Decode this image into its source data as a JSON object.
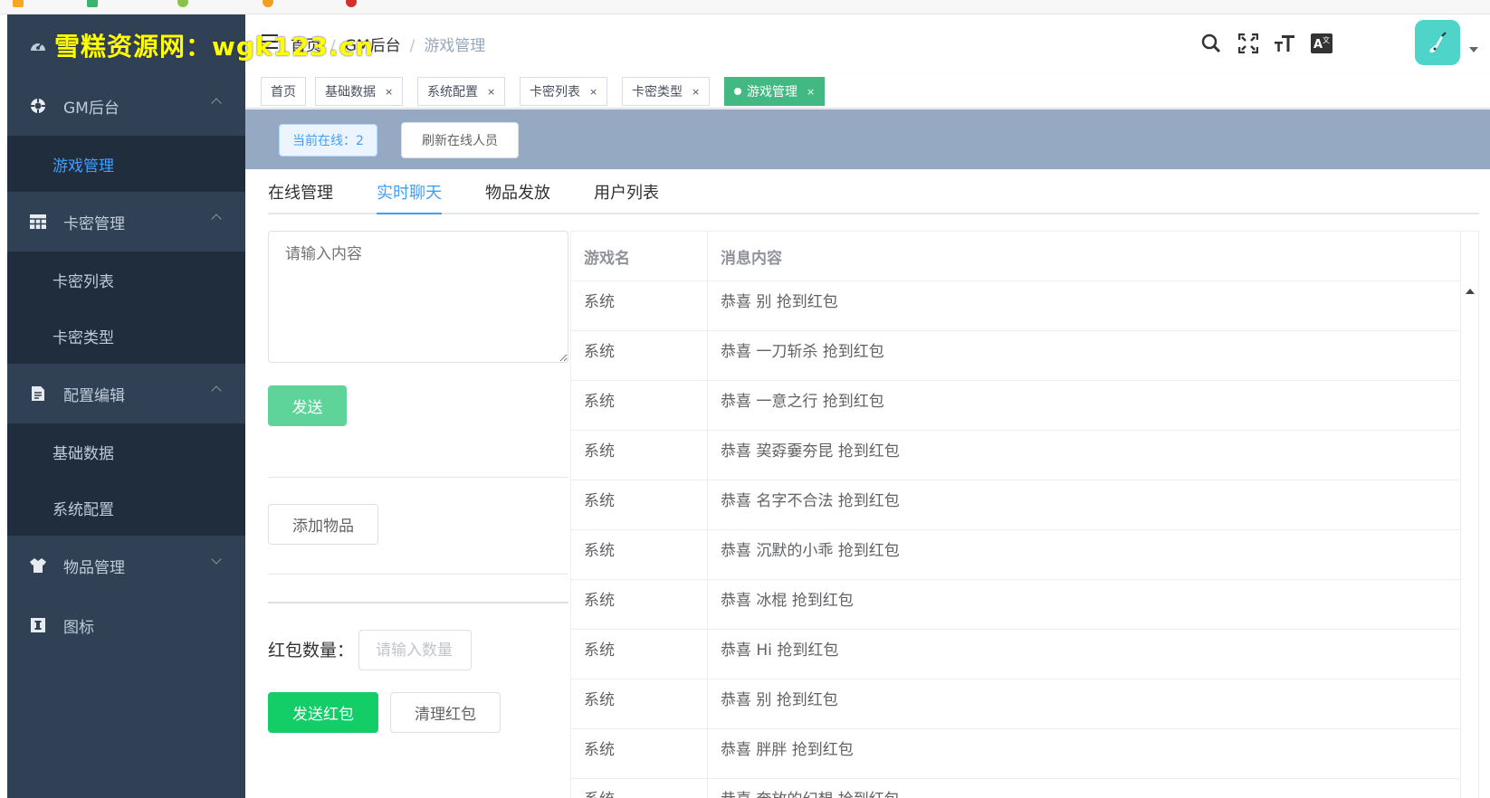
{
  "watermark": "雪糕资源网：wgk123.cn",
  "sidebar": {
    "groups": [
      {
        "label": "GM后台",
        "icon": "compass-icon",
        "expanded": true,
        "items": [
          {
            "label": "游戏管理",
            "active": true
          }
        ]
      },
      {
        "label": "卡密管理",
        "icon": "table-icon",
        "expanded": true,
        "items": [
          {
            "label": "卡密列表"
          },
          {
            "label": "卡密类型"
          }
        ]
      },
      {
        "label": "配置编辑",
        "icon": "document-icon",
        "expanded": true,
        "items": [
          {
            "label": "基础数据"
          },
          {
            "label": "系统配置"
          }
        ]
      },
      {
        "label": "物品管理",
        "icon": "shirt-icon",
        "expanded": false,
        "items": []
      },
      {
        "label": "图标",
        "icon": "info-icon",
        "expanded": false,
        "items": []
      }
    ]
  },
  "header": {
    "breadcrumb": [
      "首页",
      "GM后台",
      "游戏管理"
    ]
  },
  "tags": [
    {
      "label": "首页"
    },
    {
      "label": "基础数据"
    },
    {
      "label": "系统配置"
    },
    {
      "label": "卡密列表"
    },
    {
      "label": "卡密类型"
    },
    {
      "label": "游戏管理",
      "active": true
    }
  ],
  "online": {
    "count_label": "当前在线：2",
    "refresh_label": "刷新在线人员"
  },
  "tabs": [
    "在线管理",
    "实时聊天",
    "物品发放",
    "用户列表"
  ],
  "active_tab": "实时聊天",
  "chat": {
    "placeholder": "请输入内容",
    "send_label": "发送",
    "add_item_label": "添加物品",
    "redpacket_label": "红包数量：",
    "redpacket_placeholder": "请输入数量",
    "send_redpacket_label": "发送红包",
    "clear_redpacket_label": "清理红包"
  },
  "table": {
    "columns": [
      "游戏名",
      "消息内容"
    ],
    "rows": [
      [
        "系统",
        "恭喜 别 抢到红包"
      ],
      [
        "系统",
        "恭喜 一刀斩杀 抢到红包"
      ],
      [
        "系统",
        "恭喜 一意之行 抢到红包"
      ],
      [
        "系统",
        "恭喜 巭孬嫑夯昆 抢到红包"
      ],
      [
        "系统",
        "恭喜 名字不合法 抢到红包"
      ],
      [
        "系统",
        "恭喜 沉默的小乖 抢到红包"
      ],
      [
        "系统",
        "恭喜 冰棍 抢到红包"
      ],
      [
        "系统",
        "恭喜 Hi 抢到红包"
      ],
      [
        "系统",
        "恭喜 别 抢到红包"
      ],
      [
        "系统",
        "恭喜 胖胖 抢到红包"
      ],
      [
        "系统",
        "恭喜 奔放的幻想 抢到红包"
      ]
    ]
  },
  "colors": {
    "sidebar_bg": "#304156",
    "submenu_bg": "#1f2d3d",
    "active_link": "#409eff",
    "active_tag": "#42b983",
    "send_redpacket": "#13ce66",
    "online_bar": "#95a9c2"
  }
}
